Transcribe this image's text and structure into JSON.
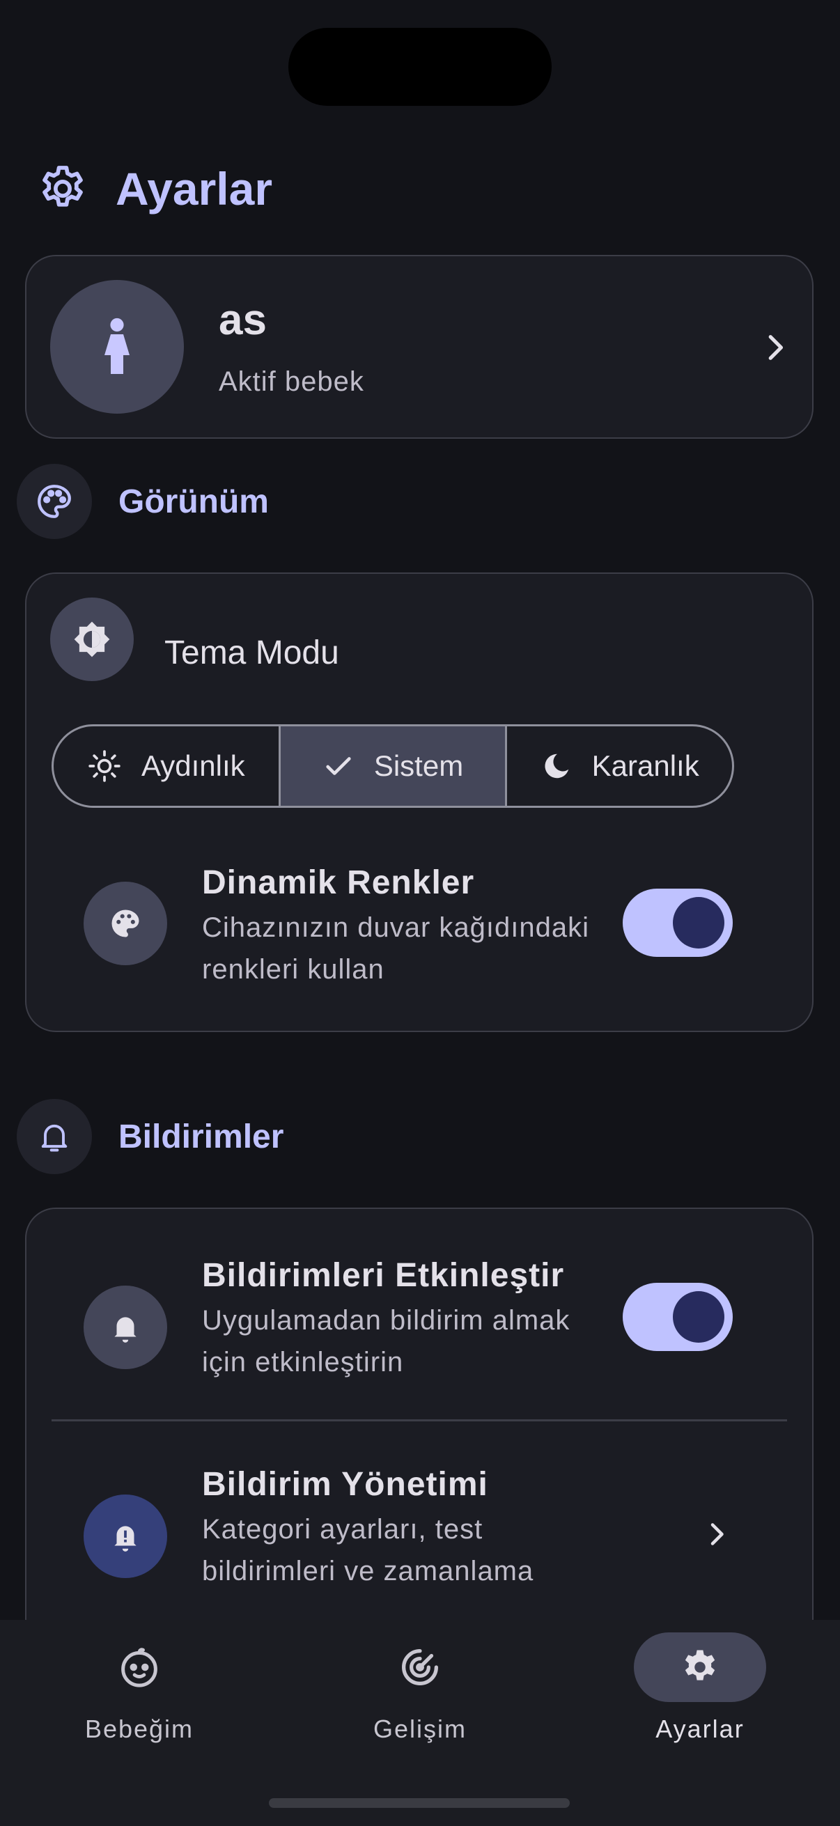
{
  "header": {
    "title": "Ayarlar",
    "icon": "gear-icon"
  },
  "profile": {
    "name": "as",
    "subtitle": "Aktif bebek",
    "icon": "baby-icon"
  },
  "appearance": {
    "section_title": "Görünüm",
    "theme_label": "Tema Modu",
    "theme_options": [
      {
        "label": "Aydınlık",
        "icon": "sun-icon",
        "selected": false
      },
      {
        "label": "Sistem",
        "icon": "check-icon",
        "selected": true
      },
      {
        "label": "Karanlık",
        "icon": "moon-icon",
        "selected": false
      }
    ],
    "dynamic_colors": {
      "title": "Dinamik Renkler",
      "subtitle": "Cihazınızın duvar kağıdındaki renkleri kullan",
      "enabled": true
    }
  },
  "notifications": {
    "section_title": "Bildirimler",
    "enable": {
      "title": "Bildirimleri Etkinleştir",
      "subtitle": "Uygulamadan bildirim almak için etkinleştirin",
      "enabled": true
    },
    "management": {
      "title": "Bildirim Yönetimi",
      "subtitle": "Kategori ayarları, test bildirimleri ve zamanlama"
    }
  },
  "nav": {
    "items": [
      {
        "label": "Bebeğim",
        "icon": "baby-face-icon",
        "active": false
      },
      {
        "label": "Gelişim",
        "icon": "growth-icon",
        "active": false
      },
      {
        "label": "Ayarlar",
        "icon": "gear-icon",
        "active": true
      }
    ]
  },
  "colors": {
    "background": "#121318",
    "accent": "#bfc2ff",
    "card": "#1b1c23",
    "toggle_knob": "#272b5e"
  }
}
